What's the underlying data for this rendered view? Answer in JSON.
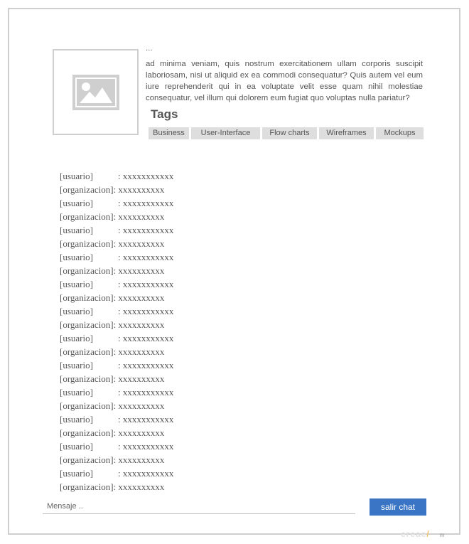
{
  "description": {
    "cut_line": "...",
    "text": "ad minima veniam, quis nostrum exercitationem ullam corporis suscipit laboriosam, nisi ut aliquid ex ea commodi consequatur? Quis autem vel eum iure reprehenderit qui in ea voluptate velit esse quam nihil molestiae consequatur, vel illum qui dolorem eum fugiat quo voluptas nulla pariatur?"
  },
  "tags": {
    "title": "Tags",
    "items": [
      "Business",
      "User-Interface",
      "Flow charts",
      "Wireframes",
      "Mockups"
    ]
  },
  "chat": {
    "messages": [
      {
        "sender": "[usuario]",
        "text": ": xxxxxxxxxxx"
      },
      {
        "sender": "[organizacion]",
        "text": ": xxxxxxxxxx"
      },
      {
        "sender": "[usuario]",
        "text": ": xxxxxxxxxxx"
      },
      {
        "sender": "[organizacion]",
        "text": ": xxxxxxxxxx"
      },
      {
        "sender": "[usuario]",
        "text": ": xxxxxxxxxxx"
      },
      {
        "sender": "[organizacion]",
        "text": ": xxxxxxxxxx"
      },
      {
        "sender": "[usuario]",
        "text": ": xxxxxxxxxxx"
      },
      {
        "sender": "[organizacion]",
        "text": ": xxxxxxxxxx"
      },
      {
        "sender": "[usuario]",
        "text": ": xxxxxxxxxxx"
      },
      {
        "sender": "[organizacion]",
        "text": ": xxxxxxxxxx"
      },
      {
        "sender": "[usuario]",
        "text": ": xxxxxxxxxxx"
      },
      {
        "sender": "[organizacion]",
        "text": ": xxxxxxxxxx"
      },
      {
        "sender": "[usuario]",
        "text": ": xxxxxxxxxxx"
      },
      {
        "sender": "[organizacion]",
        "text": ": xxxxxxxxxx"
      },
      {
        "sender": "[usuario]",
        "text": ": xxxxxxxxxxx"
      },
      {
        "sender": "[organizacion]",
        "text": ": xxxxxxxxxx"
      },
      {
        "sender": "[usuario]",
        "text": ": xxxxxxxxxxx"
      },
      {
        "sender": "[organizacion]",
        "text": ": xxxxxxxxxx"
      },
      {
        "sender": "[usuario]",
        "text": ": xxxxxxxxxxx"
      },
      {
        "sender": "[organizacion]",
        "text": ": xxxxxxxxxx"
      },
      {
        "sender": "[usuario]",
        "text": ": xxxxxxxxxxx"
      },
      {
        "sender": "[organizacion]",
        "text": ": xxxxxxxxxx"
      },
      {
        "sender": "[usuario]",
        "text": ": xxxxxxxxxxx"
      },
      {
        "sender": "[organizacion]",
        "text": ": xxxxxxxxxx"
      }
    ]
  },
  "composer": {
    "placeholder": "Mensaje ..",
    "value": "",
    "send_label": "salir chat"
  },
  "colors": {
    "accent": "#3a74c4",
    "tag_bg": "#dedede",
    "border": "#cfcfcf"
  },
  "icons": {
    "image_placeholder": "image-placeholder-icon"
  }
}
